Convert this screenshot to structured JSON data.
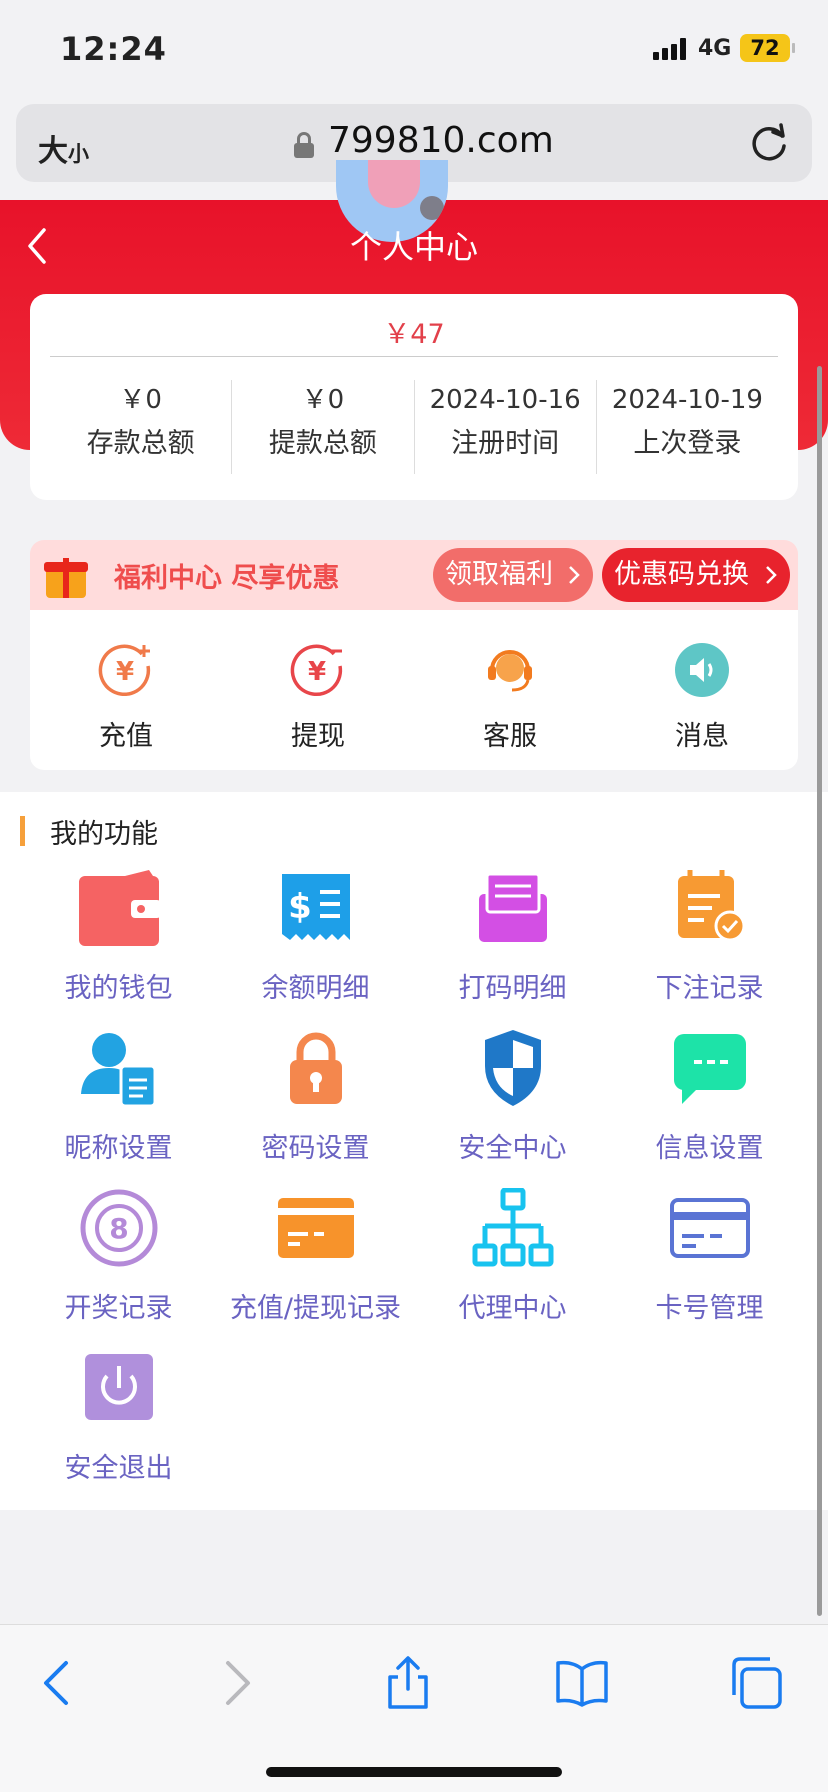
{
  "status_bar": {
    "time": "12:24",
    "network": "4G",
    "battery": "72"
  },
  "browser": {
    "text_size_label": "大",
    "text_size_small": "小",
    "url": "799810.com"
  },
  "header": {
    "title": "个人中心"
  },
  "account": {
    "balance": "￥47",
    "stats": [
      {
        "value": "￥0",
        "label": "存款总额"
      },
      {
        "value": "￥0",
        "label": "提款总额"
      },
      {
        "value": "2024-10-16",
        "label": "注册时间"
      },
      {
        "value": "2024-10-19",
        "label": "上次登录"
      }
    ]
  },
  "welfare": {
    "text": "福利中心 尽享优惠",
    "claim_label": "领取福利",
    "promo_label": "优惠码兑换"
  },
  "quick_actions": [
    {
      "label": "充值",
      "icon": "recharge-icon"
    },
    {
      "label": "提现",
      "icon": "withdraw-icon"
    },
    {
      "label": "客服",
      "icon": "customer-service-icon"
    },
    {
      "label": "消息",
      "icon": "message-icon"
    }
  ],
  "functions": {
    "title": "我的功能",
    "items": [
      {
        "label": "我的钱包",
        "icon": "wallet-icon"
      },
      {
        "label": "余额明细",
        "icon": "balance-receipt-icon"
      },
      {
        "label": "打码明细",
        "icon": "betting-code-icon"
      },
      {
        "label": "下注记录",
        "icon": "bet-record-icon"
      },
      {
        "label": "昵称设置",
        "icon": "nickname-icon"
      },
      {
        "label": "密码设置",
        "icon": "lock-icon"
      },
      {
        "label": "安全中心",
        "icon": "shield-icon"
      },
      {
        "label": "信息设置",
        "icon": "chat-bubble-icon"
      },
      {
        "label": "开奖记录",
        "icon": "lottery-ball-icon"
      },
      {
        "label": "充值/提现记录",
        "icon": "card-record-icon"
      },
      {
        "label": "代理中心",
        "icon": "org-chart-icon"
      },
      {
        "label": "卡号管理",
        "icon": "bank-card-icon"
      },
      {
        "label": "安全退出",
        "icon": "power-icon"
      }
    ]
  },
  "colors": {
    "brand_red": "#e8122a",
    "function_label": "#6a63c2",
    "accent_orange": "#f6a03b"
  }
}
